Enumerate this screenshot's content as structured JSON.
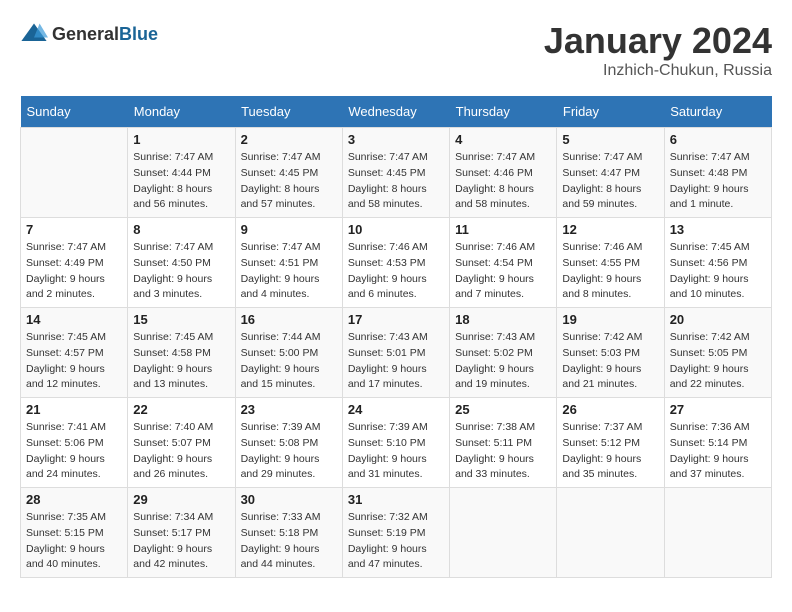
{
  "logo": {
    "general": "General",
    "blue": "Blue"
  },
  "title": "January 2024",
  "subtitle": "Inzhich-Chukun, Russia",
  "days_header": [
    "Sunday",
    "Monday",
    "Tuesday",
    "Wednesday",
    "Thursday",
    "Friday",
    "Saturday"
  ],
  "weeks": [
    [
      {
        "num": "",
        "info": ""
      },
      {
        "num": "1",
        "info": "Sunrise: 7:47 AM\nSunset: 4:44 PM\nDaylight: 8 hours\nand 56 minutes."
      },
      {
        "num": "2",
        "info": "Sunrise: 7:47 AM\nSunset: 4:45 PM\nDaylight: 8 hours\nand 57 minutes."
      },
      {
        "num": "3",
        "info": "Sunrise: 7:47 AM\nSunset: 4:45 PM\nDaylight: 8 hours\nand 58 minutes."
      },
      {
        "num": "4",
        "info": "Sunrise: 7:47 AM\nSunset: 4:46 PM\nDaylight: 8 hours\nand 58 minutes."
      },
      {
        "num": "5",
        "info": "Sunrise: 7:47 AM\nSunset: 4:47 PM\nDaylight: 8 hours\nand 59 minutes."
      },
      {
        "num": "6",
        "info": "Sunrise: 7:47 AM\nSunset: 4:48 PM\nDaylight: 9 hours\nand 1 minute."
      }
    ],
    [
      {
        "num": "7",
        "info": "Sunrise: 7:47 AM\nSunset: 4:49 PM\nDaylight: 9 hours\nand 2 minutes."
      },
      {
        "num": "8",
        "info": "Sunrise: 7:47 AM\nSunset: 4:50 PM\nDaylight: 9 hours\nand 3 minutes."
      },
      {
        "num": "9",
        "info": "Sunrise: 7:47 AM\nSunset: 4:51 PM\nDaylight: 9 hours\nand 4 minutes."
      },
      {
        "num": "10",
        "info": "Sunrise: 7:46 AM\nSunset: 4:53 PM\nDaylight: 9 hours\nand 6 minutes."
      },
      {
        "num": "11",
        "info": "Sunrise: 7:46 AM\nSunset: 4:54 PM\nDaylight: 9 hours\nand 7 minutes."
      },
      {
        "num": "12",
        "info": "Sunrise: 7:46 AM\nSunset: 4:55 PM\nDaylight: 9 hours\nand 8 minutes."
      },
      {
        "num": "13",
        "info": "Sunrise: 7:45 AM\nSunset: 4:56 PM\nDaylight: 9 hours\nand 10 minutes."
      }
    ],
    [
      {
        "num": "14",
        "info": "Sunrise: 7:45 AM\nSunset: 4:57 PM\nDaylight: 9 hours\nand 12 minutes."
      },
      {
        "num": "15",
        "info": "Sunrise: 7:45 AM\nSunset: 4:58 PM\nDaylight: 9 hours\nand 13 minutes."
      },
      {
        "num": "16",
        "info": "Sunrise: 7:44 AM\nSunset: 5:00 PM\nDaylight: 9 hours\nand 15 minutes."
      },
      {
        "num": "17",
        "info": "Sunrise: 7:43 AM\nSunset: 5:01 PM\nDaylight: 9 hours\nand 17 minutes."
      },
      {
        "num": "18",
        "info": "Sunrise: 7:43 AM\nSunset: 5:02 PM\nDaylight: 9 hours\nand 19 minutes."
      },
      {
        "num": "19",
        "info": "Sunrise: 7:42 AM\nSunset: 5:03 PM\nDaylight: 9 hours\nand 21 minutes."
      },
      {
        "num": "20",
        "info": "Sunrise: 7:42 AM\nSunset: 5:05 PM\nDaylight: 9 hours\nand 22 minutes."
      }
    ],
    [
      {
        "num": "21",
        "info": "Sunrise: 7:41 AM\nSunset: 5:06 PM\nDaylight: 9 hours\nand 24 minutes."
      },
      {
        "num": "22",
        "info": "Sunrise: 7:40 AM\nSunset: 5:07 PM\nDaylight: 9 hours\nand 26 minutes."
      },
      {
        "num": "23",
        "info": "Sunrise: 7:39 AM\nSunset: 5:08 PM\nDaylight: 9 hours\nand 29 minutes."
      },
      {
        "num": "24",
        "info": "Sunrise: 7:39 AM\nSunset: 5:10 PM\nDaylight: 9 hours\nand 31 minutes."
      },
      {
        "num": "25",
        "info": "Sunrise: 7:38 AM\nSunset: 5:11 PM\nDaylight: 9 hours\nand 33 minutes."
      },
      {
        "num": "26",
        "info": "Sunrise: 7:37 AM\nSunset: 5:12 PM\nDaylight: 9 hours\nand 35 minutes."
      },
      {
        "num": "27",
        "info": "Sunrise: 7:36 AM\nSunset: 5:14 PM\nDaylight: 9 hours\nand 37 minutes."
      }
    ],
    [
      {
        "num": "28",
        "info": "Sunrise: 7:35 AM\nSunset: 5:15 PM\nDaylight: 9 hours\nand 40 minutes."
      },
      {
        "num": "29",
        "info": "Sunrise: 7:34 AM\nSunset: 5:17 PM\nDaylight: 9 hours\nand 42 minutes."
      },
      {
        "num": "30",
        "info": "Sunrise: 7:33 AM\nSunset: 5:18 PM\nDaylight: 9 hours\nand 44 minutes."
      },
      {
        "num": "31",
        "info": "Sunrise: 7:32 AM\nSunset: 5:19 PM\nDaylight: 9 hours\nand 47 minutes."
      },
      {
        "num": "",
        "info": ""
      },
      {
        "num": "",
        "info": ""
      },
      {
        "num": "",
        "info": ""
      }
    ]
  ]
}
